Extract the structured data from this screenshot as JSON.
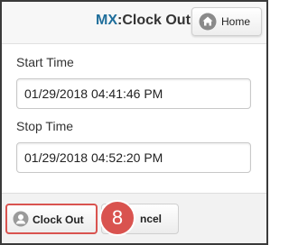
{
  "header": {
    "brand": "MX",
    "title": ":Clock Out",
    "home_label": "Home"
  },
  "form": {
    "start_label": "Start Time",
    "start_value": "01/29/2018 04:41:46 PM",
    "stop_label": "Stop Time",
    "stop_value": "01/29/2018 04:52:20 PM"
  },
  "footer": {
    "clockout_label": "Clock Out",
    "cancel_label": "ncel"
  },
  "annotation": {
    "step_number": "8"
  },
  "colors": {
    "brand": "#1f6e9b",
    "highlight": "#d9534f"
  }
}
